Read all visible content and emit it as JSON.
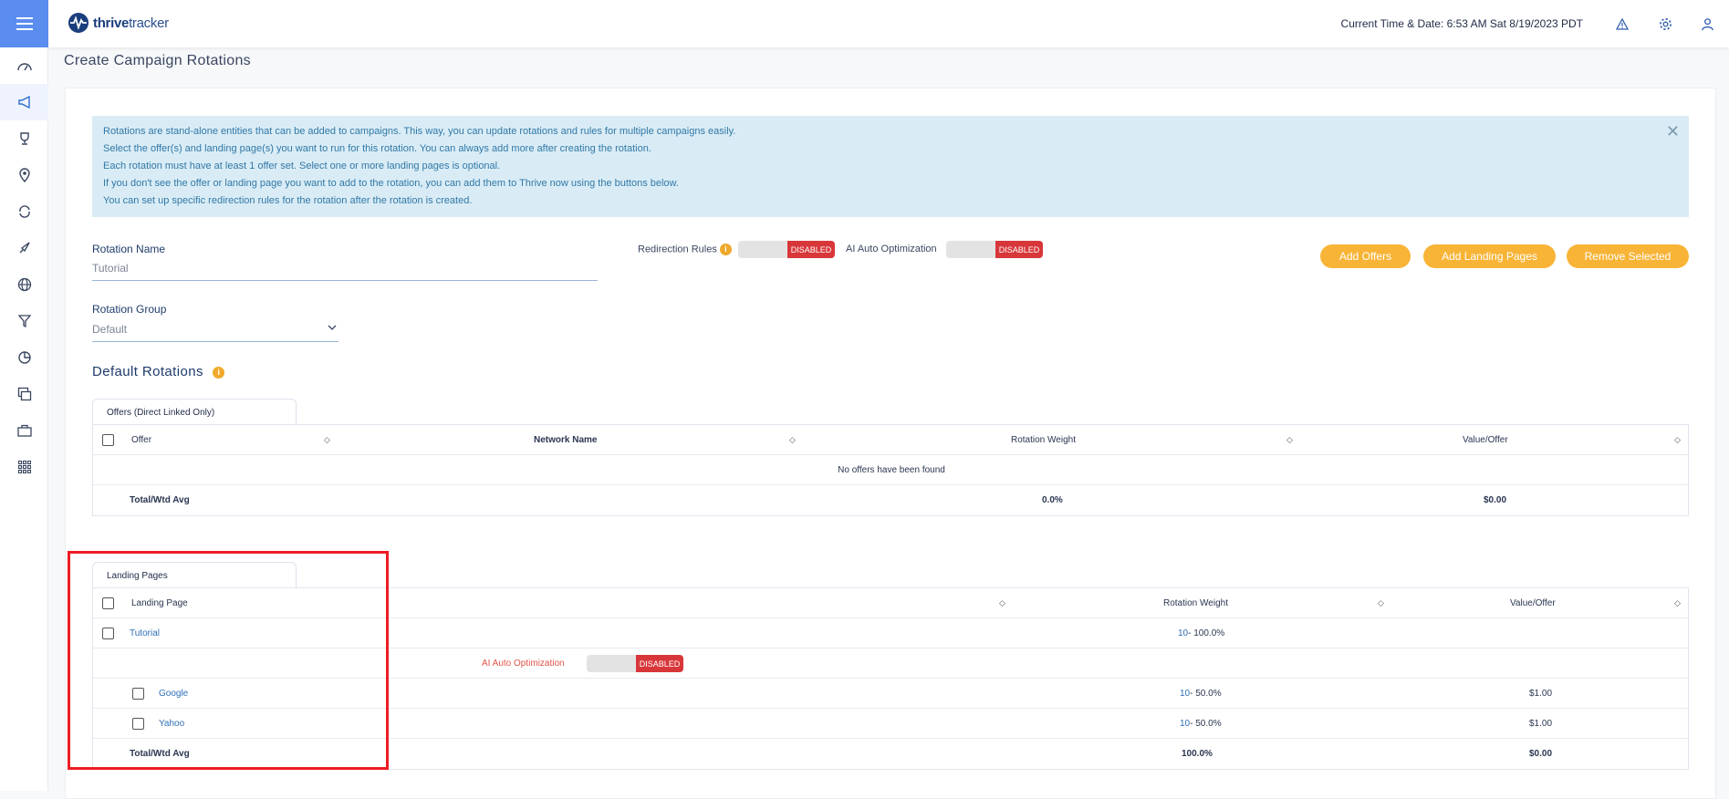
{
  "app": {
    "logo_bold": "thrive",
    "logo_thin": "tracker"
  },
  "header": {
    "time": "Current Time & Date: 6:53 AM Sat 8/19/2023 PDT"
  },
  "page": {
    "title": "Create Campaign Rotations"
  },
  "info": {
    "lines": [
      "Rotations are stand-alone entities that can be added to campaigns. This way, you can update rotations and rules for multiple campaigns easily.",
      "Select the offer(s) and landing page(s) you want to run for this rotation. You can always add more after creating the rotation.",
      "Each rotation must have at least 1 offer set. Select one or more landing pages is optional.",
      "If you don't see the offer or landing page you want to add to the rotation, you can add them to Thrive now using the buttons below.",
      "You can set up specific redirection rules for the rotation after the rotation is created."
    ],
    "close": "✕"
  },
  "form": {
    "rotation_name_label": "Rotation Name",
    "rotation_name_value": "Tutorial",
    "rotation_group_label": "Rotation Group",
    "rotation_group_value": "Default",
    "redirection_rules_label": "Redirection Rules",
    "ai_auto_label": "AI Auto Optimization",
    "toggle_state": "DISABLED",
    "info_glyph": "i"
  },
  "buttons": {
    "add_offers": "Add Offers",
    "add_landing_pages": "Add Landing Pages",
    "remove_selected": "Remove Selected"
  },
  "default_rotations": {
    "title": "Default Rotations",
    "offers_tab": "Offers (Direct Linked Only)",
    "offers_headers": {
      "offer": "Offer",
      "network": "Network Name",
      "weight": "Rotation Weight",
      "value": "Value/Offer"
    },
    "empty": "No offers have been found",
    "total_label": "Total/Wtd Avg",
    "total_weight": "0.0%",
    "total_value": "$0.00"
  },
  "landing_pages": {
    "tab": "Landing Pages",
    "headers": {
      "page": "Landing Page",
      "weight": "Rotation Weight",
      "value": "Value/Offer"
    },
    "group": {
      "name": "Tutorial",
      "weight_num": "10",
      "weight_pct": " - 100.0%"
    },
    "ai_label": "AI Auto Optimization",
    "ai_state": "DISABLED",
    "items": [
      {
        "name": "Google",
        "weight_num": "10",
        "weight_pct": " - 50.0%",
        "value": "$1.00"
      },
      {
        "name": "Yahoo",
        "weight_num": "10",
        "weight_pct": " - 50.0%",
        "value": "$1.00"
      }
    ],
    "total_label": "Total/Wtd Avg",
    "total_weight": "100.0%",
    "total_value": "$0.00"
  },
  "colors": {
    "accent": "#5b8def",
    "button": "#f8b437",
    "disabled": "#d8373a",
    "info_bg": "#d9ecf5",
    "highlight": "#ee1c25"
  },
  "icons": {
    "sidebar": [
      "dashboard-icon",
      "campaigns-icon",
      "trophy-icon",
      "location-icon",
      "rotation-icon",
      "rocket-icon",
      "globe-icon",
      "filter-icon",
      "reports-icon",
      "copy-icon",
      "briefcase-icon",
      "apps-icon"
    ],
    "header": [
      "warning-icon",
      "gear-icon",
      "user-icon"
    ]
  }
}
